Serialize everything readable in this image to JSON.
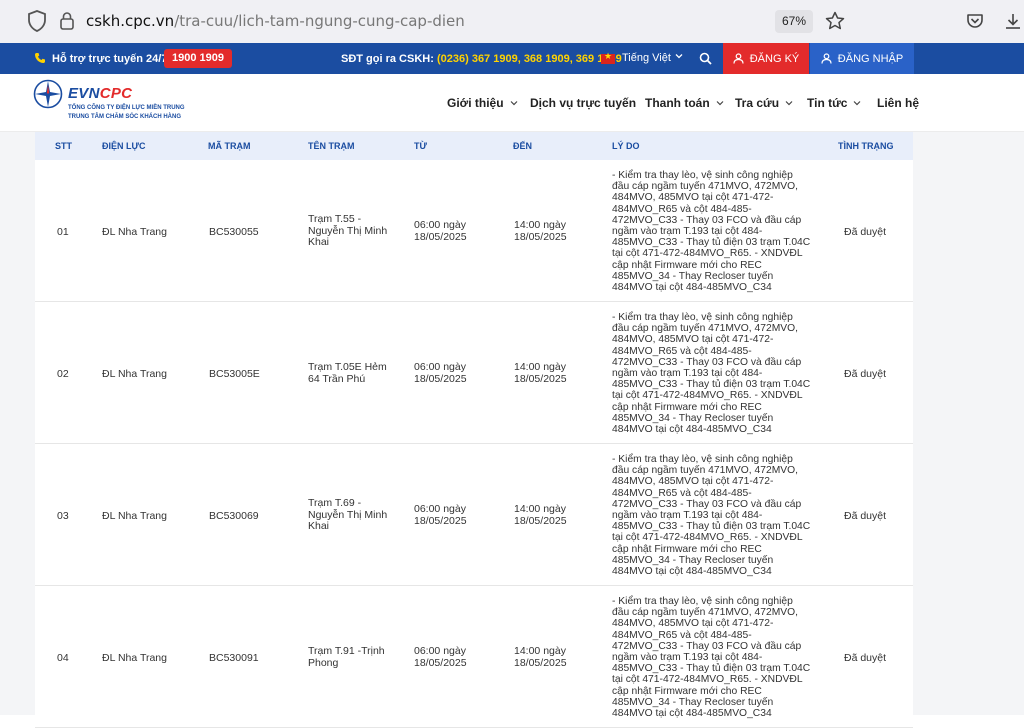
{
  "browser": {
    "url_domain": "cskh.cpc.vn",
    "url_path": "/tra-cuu/lich-tam-ngung-cung-cap-dien",
    "zoom": "67%"
  },
  "topbar": {
    "support_label": "Hỗ trợ trực tuyến 24/7:",
    "hotline": "1900 1909",
    "cskh_label": "SĐT gọi ra CSKH:",
    "cskh_numbers": "(0236) 367 1909, 368 1909, 369 1909",
    "language": "Tiếng Việt",
    "register_label": "ĐĂNG KÝ",
    "login_label": "ĐĂNG NHẬP"
  },
  "brand": {
    "name_main": "EVN",
    "name_accent": "CPC",
    "subtitle1": "TỔNG CÔNG TY ĐIỆN LỰC MIỀN TRUNG",
    "subtitle2": "TRUNG TÂM CHĂM SÓC KHÁCH HÀNG",
    "blue": "#1b4da1",
    "red": "#e32b2b"
  },
  "nav": {
    "items": [
      {
        "label": "Giới thiệu"
      },
      {
        "label": "Dịch vụ trực tuyến"
      },
      {
        "label": "Thanh toán"
      },
      {
        "label": "Tra cứu"
      },
      {
        "label": "Tin tức"
      },
      {
        "label": "Liên hệ"
      }
    ]
  },
  "table": {
    "headers": [
      "STT",
      "ĐIỆN LỰC",
      "MÃ TRẠM",
      "TÊN TRẠM",
      "TỪ",
      "ĐẾN",
      "LÝ DO",
      "TÌNH TRẠNG"
    ],
    "rows": [
      {
        "stt": "01",
        "dien_luc": "ĐL Nha Trang",
        "ma_tram": "BC530055",
        "ten_tram": "Trạm T.55 - Nguyễn Thị Minh Khai",
        "tu": "06:00 ngày 18/05/2025",
        "den": "14:00 ngày 18/05/2025",
        "ly_do": "- Kiểm tra thay lèo, vệ sinh công nghiệp đầu cáp ngầm tuyến 471MVO, 472MVO, 484MVO, 485MVO tại cột 471-472-484MVO_R65 và cột 484-485-472MVO_C33 - Thay 03 FCO và đầu cáp ngầm vào trạm T.193 tại cột 484-485MVO_C33 - Thay tủ điện 03 trạm T.04C tại cột 471-472-484MVO_R65. - XNDVĐL cập nhật Firmware mới cho REC 485MVO_34 - Thay Recloser tuyến 484MVO tại cột 484-485MVO_C34",
        "tinh_trang": "Đã duyệt"
      },
      {
        "stt": "02",
        "dien_luc": "ĐL Nha Trang",
        "ma_tram": "BC53005E",
        "ten_tram": "Trạm T.05E Hẻm 64 Trần Phú",
        "tu": "06:00 ngày 18/05/2025",
        "den": "14:00 ngày 18/05/2025",
        "ly_do": "- Kiểm tra thay lèo, vệ sinh công nghiệp đầu cáp ngầm tuyến 471MVO, 472MVO, 484MVO, 485MVO tại cột 471-472-484MVO_R65 và cột 484-485-472MVO_C33 - Thay 03 FCO và đầu cáp ngầm vào trạm T.193 tại cột 484-485MVO_C33 - Thay tủ điện 03 trạm T.04C tại cột 471-472-484MVO_R65. - XNDVĐL cập nhật Firmware mới cho REC 485MVO_34 - Thay Recloser tuyến 484MVO tại cột 484-485MVO_C34",
        "tinh_trang": "Đã duyệt"
      },
      {
        "stt": "03",
        "dien_luc": "ĐL Nha Trang",
        "ma_tram": "BC530069",
        "ten_tram": "Trạm T.69 - Nguyễn Thị Minh Khai",
        "tu": "06:00 ngày 18/05/2025",
        "den": "14:00 ngày 18/05/2025",
        "ly_do": "- Kiểm tra thay lèo, vệ sinh công nghiệp đầu cáp ngầm tuyến 471MVO, 472MVO, 484MVO, 485MVO tại cột 471-472-484MVO_R65 và cột 484-485-472MVO_C33 - Thay 03 FCO và đầu cáp ngầm vào trạm T.193 tại cột 484-485MVO_C33 - Thay tủ điện 03 trạm T.04C tại cột 471-472-484MVO_R65. - XNDVĐL cập nhật Firmware mới cho REC 485MVO_34 - Thay Recloser tuyến 484MVO tại cột 484-485MVO_C34",
        "tinh_trang": "Đã duyệt"
      },
      {
        "stt": "04",
        "dien_luc": "ĐL Nha Trang",
        "ma_tram": "BC530091",
        "ten_tram": "Trạm T.91 -Trịnh Phong",
        "tu": "06:00 ngày 18/05/2025",
        "den": "14:00 ngày 18/05/2025",
        "ly_do": "- Kiểm tra thay lèo, vệ sinh công nghiệp đầu cáp ngầm tuyến 471MVO, 472MVO, 484MVO, 485MVO tại cột 471-472-484MVO_R65 và cột 484-485-472MVO_C33 - Thay 03 FCO và đầu cáp ngầm vào trạm T.193 tại cột 484-485MVO_C33 - Thay tủ điện 03 trạm T.04C tại cột 471-472-484MVO_R65. - XNDVĐL cập nhật Firmware mới cho REC 485MVO_34 - Thay Recloser tuyến 484MVO tại cột 484-485MVO_C34",
        "tinh_trang": "Đã duyệt"
      }
    ]
  }
}
